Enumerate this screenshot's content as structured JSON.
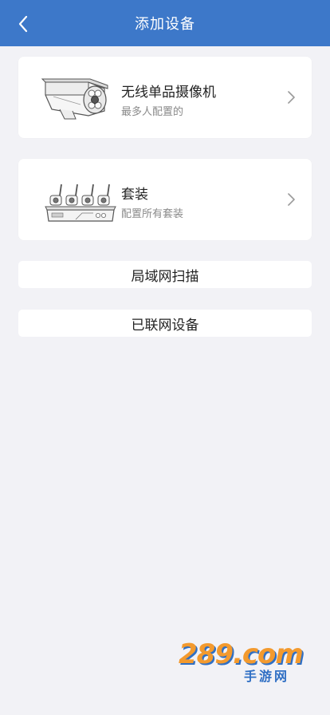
{
  "header": {
    "title": "添加设备",
    "back_icon": "chevron-left-icon",
    "color": "#3d78c9"
  },
  "devices": [
    {
      "name": "无线单品摄像机",
      "desc": "最多人配置的",
      "icon": "bullet-camera-icon"
    },
    {
      "name": "套装",
      "desc": "配置所有套装",
      "icon": "nvr-kit-icon"
    }
  ],
  "actions": {
    "lan_scan": "局域网扫描",
    "networked": "已联网设备"
  },
  "watermark": {
    "brand": "289.com",
    "sub": "手游网"
  }
}
